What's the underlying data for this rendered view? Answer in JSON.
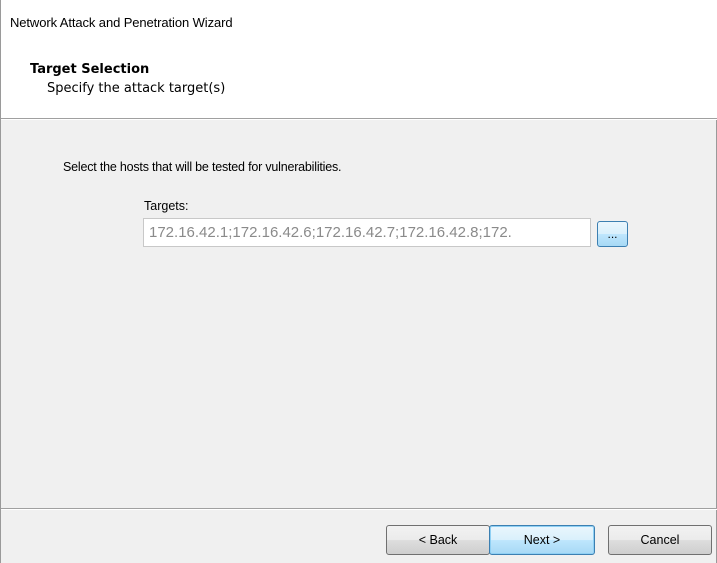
{
  "window": {
    "title": "Network Attack and Penetration Wizard"
  },
  "header": {
    "title": "Target Selection",
    "subtitle": "Specify the attack target(s)"
  },
  "main": {
    "instruction": "Select the hosts that will be tested for vulnerabilities.",
    "targets_label": "Targets:",
    "targets_value": "172.16.42.1;172.16.42.6;172.16.42.7;172.16.42.8;172.",
    "browse_label": "..."
  },
  "footer": {
    "back_label": "< Back",
    "next_label": "Next >",
    "cancel_label": "Cancel"
  },
  "colors": {
    "background": "#f0f0f0",
    "header_background": "#ffffff",
    "accent_border": "#3c7fb1",
    "disabled_text": "#8a8a8a"
  }
}
